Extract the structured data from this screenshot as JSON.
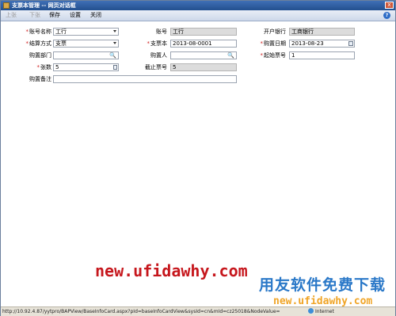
{
  "window": {
    "title": "支票本管理 -- 网页对话框",
    "close_glyph": "x"
  },
  "toolbar": {
    "prev": "上张",
    "next": "下张",
    "save": "保存",
    "settings": "设置",
    "close": "关闭",
    "help_glyph": "?"
  },
  "form": {
    "account_name": {
      "label": "账号名称",
      "value": "工行"
    },
    "account_no": {
      "label": "账号",
      "value": "工行"
    },
    "bank": {
      "label": "开户银行",
      "value": "工商银行"
    },
    "settle_method": {
      "label": "结算方式",
      "value": "支票"
    },
    "checkbook": {
      "label": "支票本",
      "value": "2013-08-0001"
    },
    "purchase_date": {
      "label": "购置日期",
      "value": "2013-08-23"
    },
    "purchase_dept": {
      "label": "购置部门",
      "value": ""
    },
    "purchaser": {
      "label": "购置人",
      "value": ""
    },
    "start_no": {
      "label": "起始票号",
      "value": "1"
    },
    "count": {
      "label": "张数",
      "value": "5"
    },
    "end_no": {
      "label": "截止票号",
      "value": "5"
    },
    "remark": {
      "label": "购置备注",
      "value": ""
    },
    "required_mark": "*",
    "search_glyph": "🔍"
  },
  "watermark": {
    "url_text": "new.ufidawhy.com",
    "brand_text": "用友软件免费下载",
    "url_text2": "new.ufidawhy.com"
  },
  "statusbar": {
    "url": "http://10.92.4.87/yytpro/BAPView/BaseInfoCard.aspx?pId=baseInfoCardView&sysId=cn&mId=cz25018&NodeValue=",
    "zone": "Internet"
  },
  "colors": {
    "title_bar": "#23508f",
    "required": "#d02020",
    "watermark_red": "#c6171d",
    "watermark_blue": "#2a78c8",
    "watermark_orange": "#f0a528"
  }
}
